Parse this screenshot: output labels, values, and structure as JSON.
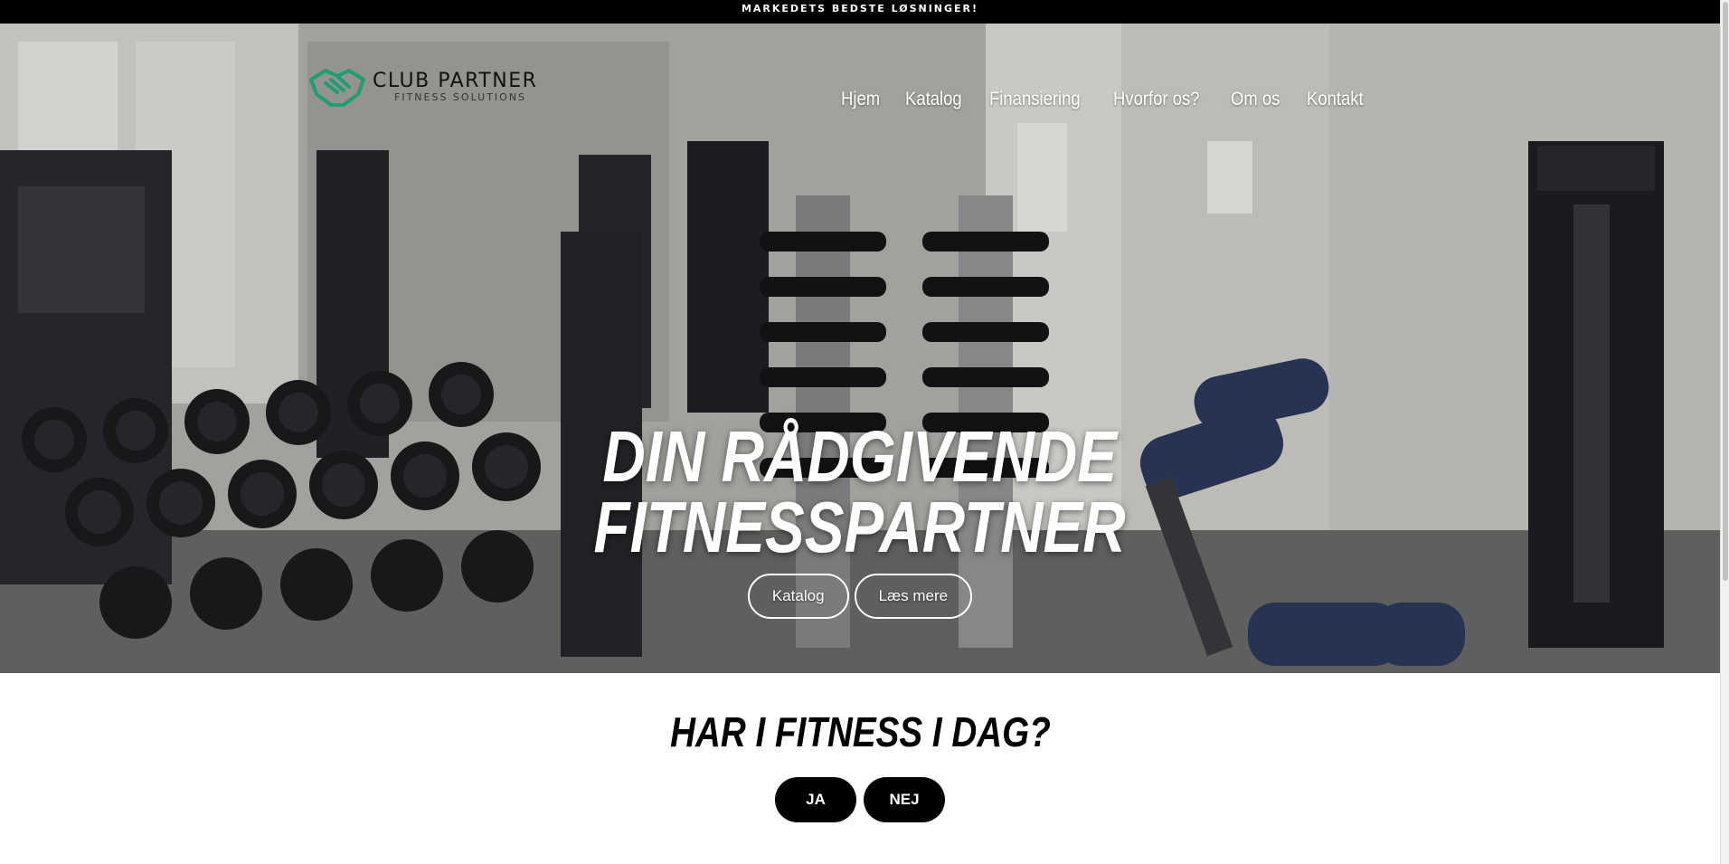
{
  "announcement": {
    "text": "MARKEDETS BEDSTE LØSNINGER!"
  },
  "logo": {
    "icon": "handshake-icon",
    "brand": "CLUB PARTNER",
    "tagline": "FITNESS SOLUTIONS",
    "accent_color": "#1f9e73"
  },
  "nav": {
    "items": [
      {
        "label": "Hjem"
      },
      {
        "label": "Katalog"
      },
      {
        "label": "Finansiering"
      },
      {
        "label": "Hvorfor os?"
      },
      {
        "label": "Om os"
      },
      {
        "label": "Kontakt"
      }
    ]
  },
  "hero": {
    "title_line1": "DIN RÅDGIVENDE",
    "title_line2": "FITNESSPARTNER",
    "buttons": [
      {
        "label": "Katalog"
      },
      {
        "label": "Læs mere"
      }
    ]
  },
  "question": {
    "text": "HAR I FITNESS I DAG?",
    "yes_label": "JA",
    "no_label": "NEJ"
  }
}
